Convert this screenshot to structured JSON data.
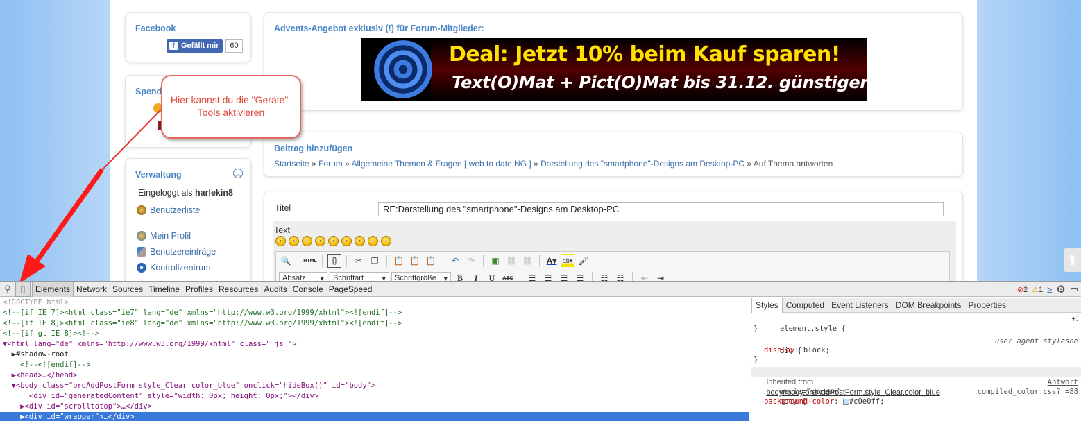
{
  "sidebar": {
    "facebook": {
      "title": "Facebook",
      "like_label": "Gefällt mir",
      "like_count": "60"
    },
    "spenden": {
      "title_partial": "Spend"
    },
    "verwaltung": {
      "title": "Verwaltung",
      "logged_in_prefix": "Eingeloggt als",
      "username": "harlekin8",
      "items": [
        "Benutzerliste",
        "Mein Profil",
        "Benutzereinträge",
        "Kontrollzentrum"
      ]
    }
  },
  "ad": {
    "title": "Advents-Angebot exklusiv (!) für Forum-Mitglieder:",
    "banner_line1": "Deal: Jetzt 10% beim Kauf sparen!",
    "banner_line2": "Text(O)Mat + Pict(O)Mat bis 31.12. günstiger"
  },
  "callout": {
    "text": "Hier kannst du die \"Geräte\"-Tools aktivieren"
  },
  "post": {
    "title": "Beitrag hinzufügen",
    "breadcrumb": [
      "Startseite",
      "Forum",
      "Allgemeine Themen & Fragen [ web to date NG ]",
      "Darstellung des \"smartphone\"-Designs am Desktop-PC",
      "Auf Thema antworten"
    ],
    "breadcrumb_sep": "»"
  },
  "form": {
    "title_label": "Titel",
    "title_value": "RE:Darstellung des \"smartphone\"-Designs am Desktop-PC",
    "text_label": "Text",
    "toolbar": {
      "format": "Absatz",
      "font": "Schriftart",
      "size": "Schriftgröße",
      "html": "HTML",
      "bold": "B",
      "italic": "I",
      "underline": "U",
      "strike": "ABC"
    }
  },
  "devtools": {
    "tabs": [
      "Elements",
      "Network",
      "Sources",
      "Timeline",
      "Profiles",
      "Resources",
      "Audits",
      "Console",
      "PageSpeed"
    ],
    "errors": "2",
    "warnings": "1",
    "dom_lines": [
      "<!DOCTYPE html>",
      "<!--[if IE 7]><html class=\"ie7\" lang=\"de\" xmlns=\"http://www.w3.org/1999/xhtml\"><![endif]-->",
      "<!--[if IE 8]><html class=\"ie8\" lang=\"de\" xmlns=\"http://www.w3.org/1999/xhtml\"><![endif]-->",
      "<!--[if gt IE 8]><!-->",
      "▼<html lang=\"de\" xmlns=\"http://www.w3.org/1999/xhtml\" class=\" js \">",
      "  ▶#shadow-root",
      "    <!--<![endif]-->",
      "  ▶<head>…</head>",
      "  ▼<body class=\"brdAddPostForm style_Clear color_blue\" onclick=\"hideBox()\" id=\"body\">",
      "      <div id=\"generatedContent\" style=\"width: 0px; height: 0px;\"></div>",
      "    ▶<div id=\"scrolltotop\">…</div>",
      "    ▶<div id=\"wrapper\">…</div>"
    ],
    "styles_tabs": [
      "Styles",
      "Computed",
      "Event Listeners",
      "DOM Breakpoints",
      "Properties"
    ],
    "styles": {
      "element_style": "element.style {",
      "close": "}",
      "div_rule": "div {",
      "div_source": "user agent styleshe",
      "display_prop": "display",
      "display_val": "block;",
      "inherited_prefix": "Inherited from",
      "inherited_from": "body#body.brdAddPostForm.style_Clear.color_blue",
      "media": "media=\"screen\"",
      "media_source": "Antwort",
      "body_rule": "body {",
      "body_source": "compiled_color.css? =88",
      "bg_prop": "background-color",
      "bg_val": "#c0e0ff;"
    }
  }
}
